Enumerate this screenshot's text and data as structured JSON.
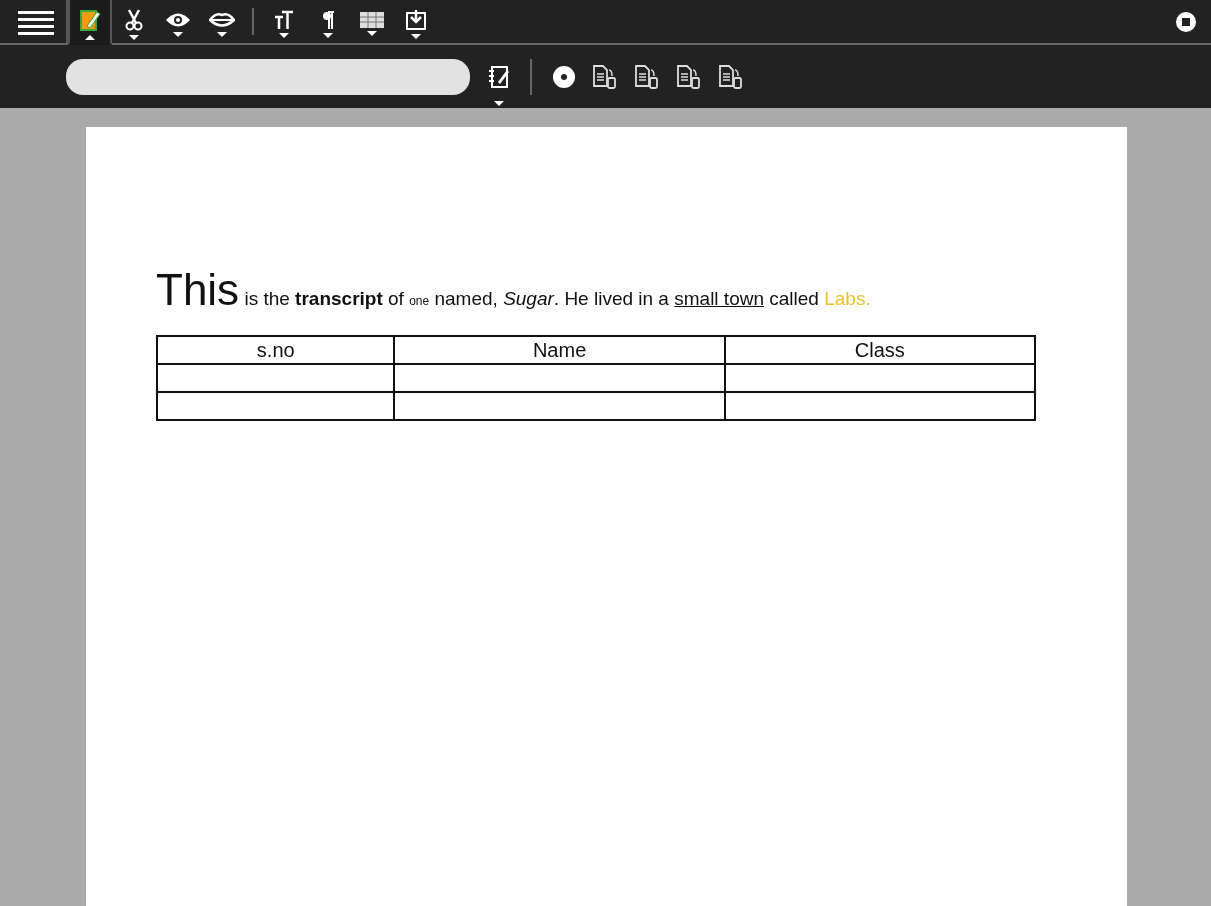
{
  "toolbar": {
    "tabs": [
      {
        "kind": "edit",
        "selected": true
      },
      {
        "kind": "cut",
        "selected": false
      },
      {
        "kind": "view",
        "selected": false
      },
      {
        "kind": "speak",
        "selected": false
      },
      {
        "kind": "text-size",
        "selected": false
      },
      {
        "kind": "paragraph",
        "selected": false
      },
      {
        "kind": "table",
        "selected": false
      },
      {
        "kind": "insert",
        "selected": false
      }
    ]
  },
  "document": {
    "paragraph": [
      {
        "kind": "large",
        "text": "This"
      },
      {
        "kind": "plain",
        "text": " is the "
      },
      {
        "kind": "bold",
        "text": "transcript"
      },
      {
        "kind": "plain",
        "text": " of "
      },
      {
        "kind": "small",
        "text": "one"
      },
      {
        "kind": "plain",
        "text": " named, "
      },
      {
        "kind": "italic",
        "text": "Sugar"
      },
      {
        "kind": "plain",
        "text": ". He lived in a "
      },
      {
        "kind": "underline",
        "text": "small town"
      },
      {
        "kind": "plain",
        "text": " called "
      },
      {
        "kind": "colored",
        "text": "Labs.",
        "color": "#e8c430"
      }
    ],
    "table": {
      "columns": [
        "s.no",
        "Name",
        "Class"
      ],
      "rows": [
        {
          "kind": "empty"
        },
        {
          "kind": "empty"
        }
      ]
    }
  }
}
